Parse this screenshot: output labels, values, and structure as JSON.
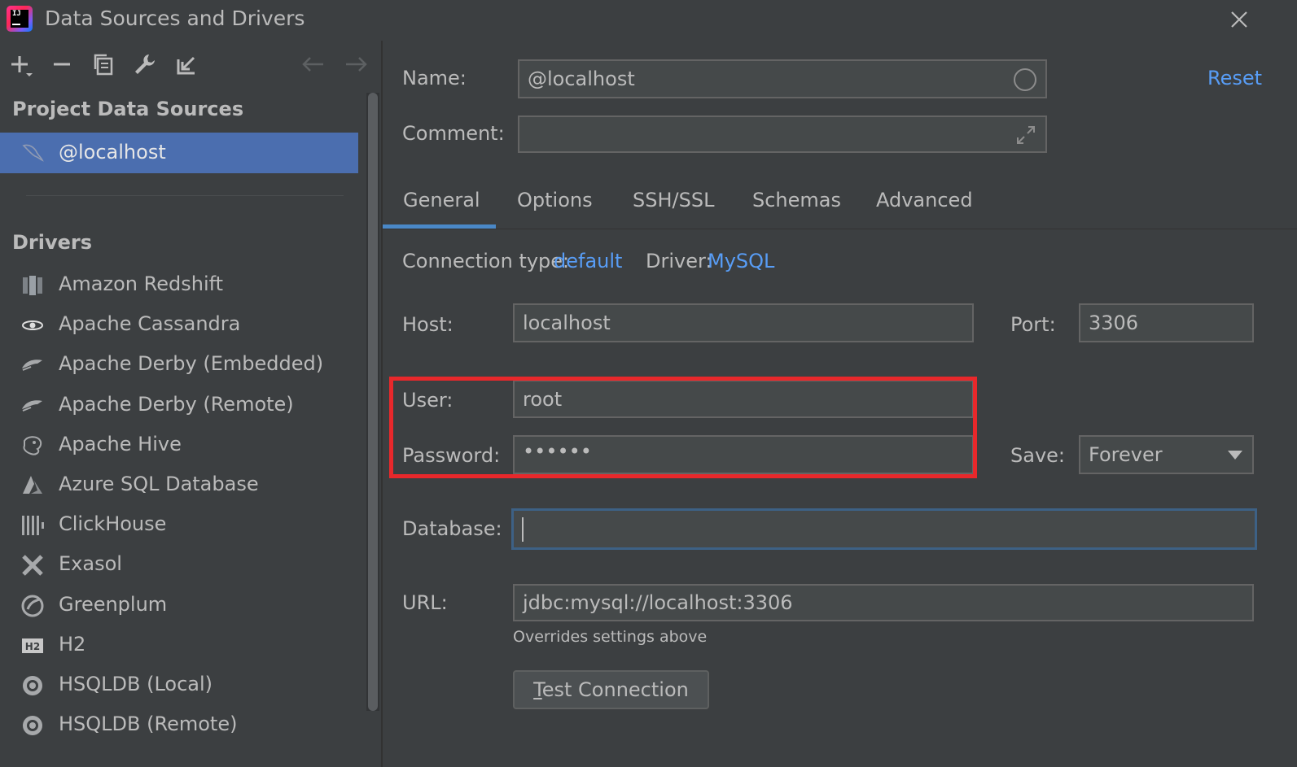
{
  "window": {
    "title": "Data Sources and Drivers",
    "logo_text": "IJ"
  },
  "left_pane": {
    "toolbar": [
      "add-icon",
      "remove-icon",
      "duplicate-icon",
      "wrench-icon",
      "import-icon",
      "back-arrow-icon",
      "forward-arrow-icon"
    ],
    "project_header": "Project Data Sources",
    "selected_source": "@localhost",
    "drivers_header": "Drivers",
    "drivers": [
      {
        "label": "Amazon Redshift",
        "icon": "redshift-icon"
      },
      {
        "label": "Apache Cassandra",
        "icon": "cassandra-icon"
      },
      {
        "label": "Apache Derby (Embedded)",
        "icon": "derby-icon"
      },
      {
        "label": "Apache Derby (Remote)",
        "icon": "derby-icon"
      },
      {
        "label": "Apache Hive",
        "icon": "hive-icon"
      },
      {
        "label": "Azure SQL Database",
        "icon": "azure-icon"
      },
      {
        "label": "ClickHouse",
        "icon": "clickhouse-icon"
      },
      {
        "label": "Exasol",
        "icon": "exasol-icon"
      },
      {
        "label": "Greenplum",
        "icon": "greenplum-icon"
      },
      {
        "label": "H2",
        "icon": "h2-icon"
      },
      {
        "label": "HSQLDB (Local)",
        "icon": "hsqldb-icon"
      },
      {
        "label": "HSQLDB (Remote)",
        "icon": "hsqldb-icon"
      }
    ]
  },
  "form": {
    "name_label": "Name:",
    "name_value": "@localhost",
    "reset_label": "Reset",
    "comment_label": "Comment:",
    "comment_value": "",
    "tabs": [
      "General",
      "Options",
      "SSH/SSL",
      "Schemas",
      "Advanced"
    ],
    "active_tab": "General",
    "connection_type_label": "Connection type:",
    "connection_type_value": "default",
    "driver_label": "Driver:",
    "driver_value": "MySQL",
    "host_label": "Host:",
    "host_value": "localhost",
    "port_label": "Port:",
    "port_value": "3306",
    "user_label": "User:",
    "user_value": "root",
    "password_label": "Password:",
    "password_value": "••••••",
    "save_label": "Save:",
    "save_value": "Forever",
    "database_label": "Database:",
    "database_value": "",
    "url_label": "URL:",
    "url_value": "jdbc:mysql://localhost:3306",
    "url_hint": "Overrides settings above",
    "test_button_first": "T",
    "test_button_rest": "est Connection"
  },
  "colors": {
    "background": "#3c3f41",
    "selection": "#4b6eaf",
    "link": "#589df6",
    "highlight_box": "#e8282b",
    "tab_underline": "#4a88c7"
  }
}
